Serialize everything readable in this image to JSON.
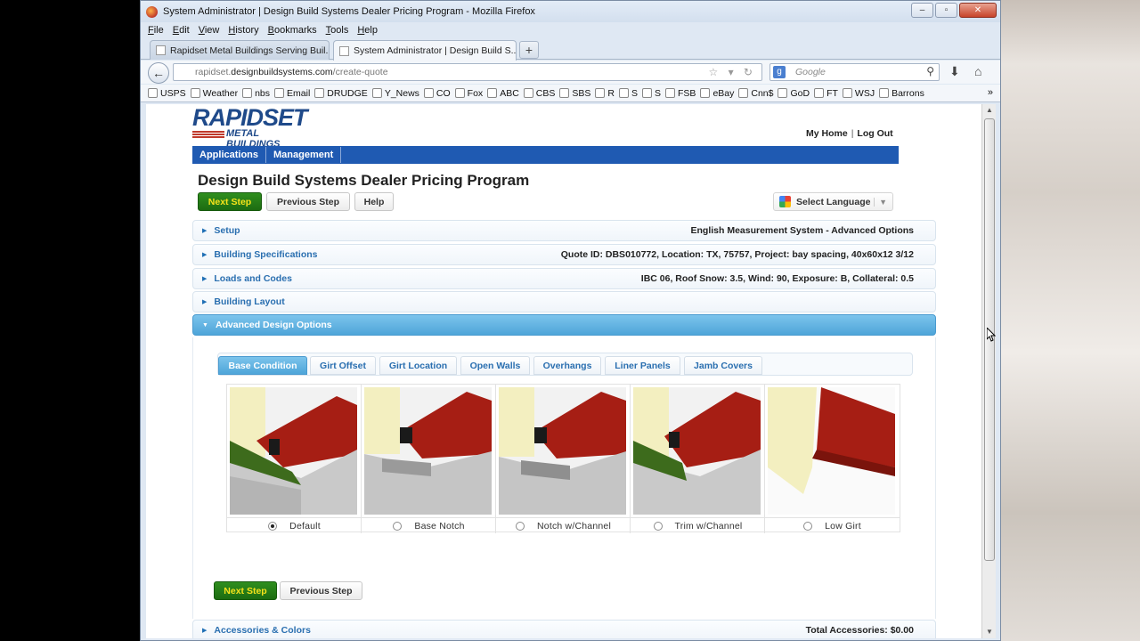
{
  "window": {
    "title": "System Administrator | Design Build Systems Dealer Pricing Program - Mozilla Firefox",
    "controls": [
      "–",
      "▫",
      "✕"
    ]
  },
  "menubar": [
    "File",
    "Edit",
    "View",
    "History",
    "Bookmarks",
    "Tools",
    "Help"
  ],
  "tabs": [
    {
      "label": "Rapidset Metal Buildings Serving Buil...",
      "active": false
    },
    {
      "label": "System Administrator | Design Build S...",
      "active": true
    }
  ],
  "new_tab_label": "+",
  "url": {
    "prefix": "rapidset.",
    "domain": "designbuildsystems.com",
    "path": "/create-quote"
  },
  "search": {
    "engine_icon": "g",
    "placeholder": "Google"
  },
  "bookmarks": [
    "USPS",
    "Weather",
    "nbs",
    "Email",
    "DRUDGE",
    "Y_News",
    "CO",
    "Fox",
    "ABC",
    "CBS",
    "SBS",
    "R",
    "S",
    "S",
    "FSB",
    "eBay",
    "Cnn$",
    "GoD",
    "FT",
    "WSJ",
    "Barrons"
  ],
  "bookmarks_more": "»",
  "site": {
    "logo_main": "RAPIDSET",
    "logo_sub": "METAL BUILDINGS",
    "toplinks": {
      "home": "My Home",
      "separator": "|",
      "logout": "Log Out"
    },
    "nav": [
      "Applications",
      "Management"
    ],
    "page_title": "Design Build Systems Dealer Pricing Program",
    "buttons": {
      "next": "Next Step",
      "previous": "Previous Step",
      "help": "Help"
    },
    "language": {
      "label": "Select Language",
      "caret": "▼"
    }
  },
  "accordion": [
    {
      "label": "Setup",
      "info": "English Measurement System - Advanced Options",
      "open": false
    },
    {
      "label": "Building Specifications",
      "info": "Quote ID: DBS010772, Location: TX, 75757, Project: bay spacing, 40x60x12 3/12",
      "open": false
    },
    {
      "label": "Loads and Codes",
      "info": "IBC 06, Roof Snow: 3.5, Wind: 90, Exposure: B, Collateral: 0.5",
      "open": false
    },
    {
      "label": "Building Layout",
      "info": "",
      "open": false
    },
    {
      "label": "Advanced Design Options",
      "info": "",
      "open": true
    }
  ],
  "subtabs": [
    "Base Condition",
    "Girt Offset",
    "Girt Location",
    "Open Walls",
    "Overhangs",
    "Liner Panels",
    "Jamb Covers"
  ],
  "active_subtab": "Base Condition",
  "base_options": [
    {
      "label": "Default",
      "selected": true,
      "icon": "default-base-image"
    },
    {
      "label": "Base Notch",
      "selected": false,
      "icon": "base-notch-image"
    },
    {
      "label": "Notch w/Channel",
      "selected": false,
      "icon": "notch-channel-image"
    },
    {
      "label": "Trim w/Channel",
      "selected": false,
      "icon": "trim-channel-image"
    },
    {
      "label": "Low Girt",
      "selected": false,
      "icon": "low-girt-image"
    }
  ],
  "panel_buttons": {
    "next": "Next Step",
    "previous": "Previous Step"
  },
  "bottom_accordion": {
    "label": "Accessories & Colors",
    "info": "Total Accessories: $0.00"
  },
  "colors": {
    "nav_blue": "#1f5ab2",
    "accent_blue": "#4ea5d9",
    "green": "#1d6b11",
    "yellow_text": "#f5e21a"
  }
}
